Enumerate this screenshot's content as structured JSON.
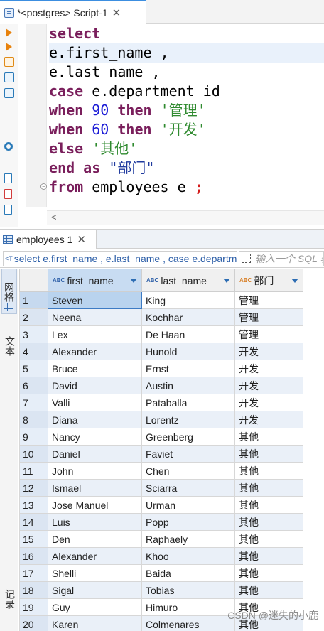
{
  "editor_tab": {
    "title": "*<postgres> Script-1",
    "close": "✕"
  },
  "editor": {
    "lines": [
      [
        {
          "t": "select",
          "c": "kw"
        }
      ],
      [
        {
          "t": "e.fir",
          "c": ""
        },
        {
          "t": "caret",
          "c": "caret"
        },
        {
          "t": "st_name ,",
          "c": ""
        }
      ],
      [
        {
          "t": "e.last_name ,",
          "c": ""
        }
      ],
      [
        {
          "t": "case",
          "c": "kw"
        },
        {
          "t": " e.department_id",
          "c": ""
        }
      ],
      [
        {
          "t": "when",
          "c": "kw"
        },
        {
          "t": " ",
          "c": ""
        },
        {
          "t": "90",
          "c": "num"
        },
        {
          "t": " ",
          "c": ""
        },
        {
          "t": "then",
          "c": "kw"
        },
        {
          "t": " ",
          "c": ""
        },
        {
          "t": "'管理'",
          "c": "str"
        }
      ],
      [
        {
          "t": "when",
          "c": "kw"
        },
        {
          "t": " ",
          "c": ""
        },
        {
          "t": "60",
          "c": "num"
        },
        {
          "t": " ",
          "c": ""
        },
        {
          "t": "then",
          "c": "kw"
        },
        {
          "t": " ",
          "c": ""
        },
        {
          "t": "'开发'",
          "c": "str"
        }
      ],
      [
        {
          "t": "else",
          "c": "kw"
        },
        {
          "t": " ",
          "c": ""
        },
        {
          "t": "'其他'",
          "c": "str"
        }
      ],
      [
        {
          "t": "end",
          "c": "kw"
        },
        {
          "t": " ",
          "c": ""
        },
        {
          "t": "as",
          "c": "kw"
        },
        {
          "t": " ",
          "c": ""
        },
        {
          "t": "\"部门\"",
          "c": "dstr"
        }
      ],
      [
        {
          "t": "from",
          "c": "kw"
        },
        {
          "t": " employees e ",
          "c": ""
        },
        {
          "t": ";",
          "c": "semi"
        }
      ]
    ],
    "current_line": 1,
    "scroll_left": "<"
  },
  "results": {
    "tab_title": "employees 1",
    "close": "✕",
    "query_prefix": "<T",
    "query_text": "select e.first_name , e.last_name , case e.department_id",
    "filter_placeholder": "输入一个 SQL 表达式来过滤结果",
    "side_tabs": {
      "grid": "网格",
      "text": "文本",
      "record": "记录"
    },
    "columns": [
      {
        "label": "first_name",
        "type": "ABC"
      },
      {
        "label": "last_name",
        "type": "ABC"
      },
      {
        "label": "部门",
        "type": "ABC"
      }
    ],
    "rows": [
      [
        "1",
        "Steven",
        "King",
        "管理"
      ],
      [
        "2",
        "Neena",
        "Kochhar",
        "管理"
      ],
      [
        "3",
        "Lex",
        "De Haan",
        "管理"
      ],
      [
        "4",
        "Alexander",
        "Hunold",
        "开发"
      ],
      [
        "5",
        "Bruce",
        "Ernst",
        "开发"
      ],
      [
        "6",
        "David",
        "Austin",
        "开发"
      ],
      [
        "7",
        "Valli",
        "Pataballa",
        "开发"
      ],
      [
        "8",
        "Diana",
        "Lorentz",
        "开发"
      ],
      [
        "9",
        "Nancy",
        "Greenberg",
        "其他"
      ],
      [
        "10",
        "Daniel",
        "Faviet",
        "其他"
      ],
      [
        "11",
        "John",
        "Chen",
        "其他"
      ],
      [
        "12",
        "Ismael",
        "Sciarra",
        "其他"
      ],
      [
        "13",
        "Jose Manuel",
        "Urman",
        "其他"
      ],
      [
        "14",
        "Luis",
        "Popp",
        "其他"
      ],
      [
        "15",
        "Den",
        "Raphaely",
        "其他"
      ],
      [
        "16",
        "Alexander",
        "Khoo",
        "其他"
      ],
      [
        "17",
        "Shelli",
        "Baida",
        "其他"
      ],
      [
        "18",
        "Sigal",
        "Tobias",
        "其他"
      ],
      [
        "19",
        "Guy",
        "Himuro",
        "其他"
      ],
      [
        "20",
        "Karen",
        "Colmenares",
        "其他"
      ]
    ]
  },
  "watermark": "CSDN @迷失的小鹿"
}
